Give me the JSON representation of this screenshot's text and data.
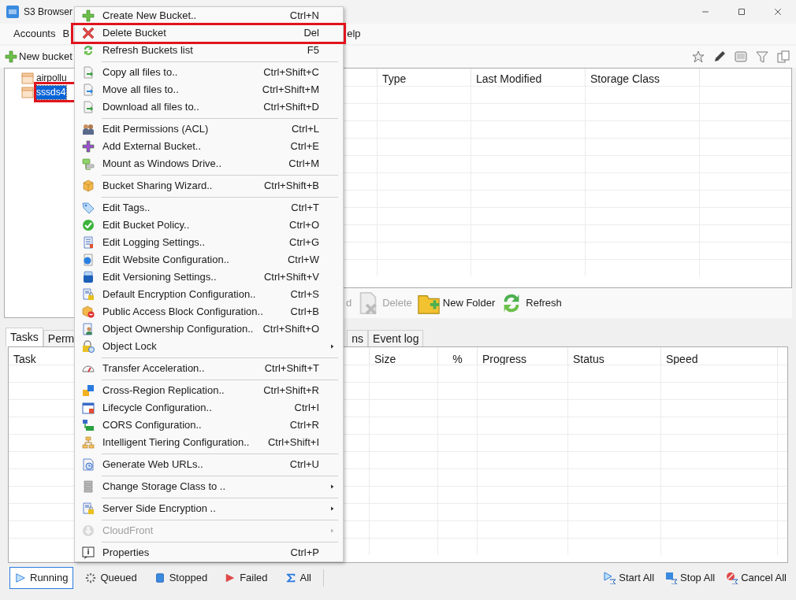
{
  "window": {
    "title": "S3 Browser"
  },
  "menu_bar": [
    "Accounts",
    "B",
    "elp"
  ],
  "toolbar": {
    "new_bucket": "New bucket"
  },
  "tree": [
    {
      "label": "airpollu",
      "selected": false,
      "highlighted": false
    },
    {
      "label": "sssds4",
      "selected": true,
      "highlighted": true
    }
  ],
  "file_list": {
    "columns": [
      "Type",
      "Last Modified",
      "Storage Class"
    ]
  },
  "file_toolbar": [
    {
      "label": "d",
      "disabled": true
    },
    {
      "label": "Delete",
      "disabled": true
    },
    {
      "label": "New Folder",
      "disabled": false
    },
    {
      "label": "Refresh",
      "disabled": false
    }
  ],
  "tabs": [
    {
      "label": "Tasks",
      "selected": true
    },
    {
      "label": "Perm",
      "selected": false
    },
    {
      "label": "ns",
      "selected": false
    },
    {
      "label": "Event log",
      "selected": false
    }
  ],
  "tasks_table": {
    "columns": [
      "Task",
      "Size",
      "%",
      "Progress",
      "Status",
      "Speed"
    ]
  },
  "task_filters": [
    {
      "label": "Running",
      "selected": true
    },
    {
      "label": "Queued",
      "selected": false
    },
    {
      "label": "Stopped",
      "selected": false
    },
    {
      "label": "Failed",
      "selected": false
    },
    {
      "label": "All",
      "selected": false
    }
  ],
  "task_actions": [
    "Start All",
    "Stop All",
    "Cancel All"
  ],
  "context_menu": [
    {
      "kind": "item",
      "label": "Create New Bucket..",
      "shortcut": "Ctrl+N",
      "highlighted": false
    },
    {
      "kind": "item",
      "label": "Delete Bucket",
      "shortcut": "Del",
      "highlighted": true
    },
    {
      "kind": "item",
      "label": "Refresh Buckets list",
      "shortcut": "F5",
      "highlighted": false
    },
    {
      "kind": "separator"
    },
    {
      "kind": "item",
      "label": "Copy all files to..",
      "shortcut": "Ctrl+Shift+C",
      "highlighted": false
    },
    {
      "kind": "item",
      "label": "Move all files to..",
      "shortcut": "Ctrl+Shift+M",
      "highlighted": false
    },
    {
      "kind": "item",
      "label": "Download all files to..",
      "shortcut": "Ctrl+Shift+D",
      "highlighted": false
    },
    {
      "kind": "separator"
    },
    {
      "kind": "item",
      "label": "Edit Permissions (ACL)",
      "shortcut": "Ctrl+L",
      "highlighted": false
    },
    {
      "kind": "item",
      "label": "Add External Bucket..",
      "shortcut": "Ctrl+E",
      "highlighted": false
    },
    {
      "kind": "item",
      "label": "Mount as Windows Drive..",
      "shortcut": "Ctrl+M",
      "highlighted": false
    },
    {
      "kind": "separator"
    },
    {
      "kind": "item",
      "label": "Bucket Sharing Wizard..",
      "shortcut": "Ctrl+Shift+B",
      "highlighted": false
    },
    {
      "kind": "separator"
    },
    {
      "kind": "item",
      "label": "Edit Tags..",
      "shortcut": "Ctrl+T",
      "highlighted": false
    },
    {
      "kind": "item",
      "label": "Edit Bucket Policy..",
      "shortcut": "Ctrl+O",
      "highlighted": false
    },
    {
      "kind": "item",
      "label": "Edit Logging Settings..",
      "shortcut": "Ctrl+G",
      "highlighted": false
    },
    {
      "kind": "item",
      "label": "Edit Website Configuration..",
      "shortcut": "Ctrl+W",
      "highlighted": false
    },
    {
      "kind": "item",
      "label": "Edit Versioning Settings..",
      "shortcut": "Ctrl+Shift+V",
      "highlighted": false
    },
    {
      "kind": "item",
      "label": "Default Encryption Configuration..",
      "shortcut": "Ctrl+S",
      "highlighted": false
    },
    {
      "kind": "item",
      "label": "Public Access Block Configuration..",
      "shortcut": "Ctrl+B",
      "highlighted": false
    },
    {
      "kind": "item",
      "label": "Object Ownership Configuration..",
      "shortcut": "Ctrl+Shift+O",
      "highlighted": false
    },
    {
      "kind": "submenu",
      "label": "Object Lock",
      "disabled": false
    },
    {
      "kind": "separator"
    },
    {
      "kind": "item",
      "label": "Transfer Acceleration..",
      "shortcut": "Ctrl+Shift+T",
      "highlighted": false
    },
    {
      "kind": "separator"
    },
    {
      "kind": "item",
      "label": "Cross-Region Replication..",
      "shortcut": "Ctrl+Shift+R",
      "highlighted": false
    },
    {
      "kind": "item",
      "label": "Lifecycle Configuration..",
      "shortcut": "Ctrl+I",
      "highlighted": false
    },
    {
      "kind": "item",
      "label": "CORS Configuration..",
      "shortcut": "Ctrl+R",
      "highlighted": false
    },
    {
      "kind": "item",
      "label": "Intelligent Tiering Configuration..",
      "shortcut": "Ctrl+Shift+I",
      "highlighted": false
    },
    {
      "kind": "separator"
    },
    {
      "kind": "item",
      "label": "Generate Web URLs..",
      "shortcut": "Ctrl+U",
      "highlighted": false
    },
    {
      "kind": "separator"
    },
    {
      "kind": "submenu",
      "label": "Change Storage Class to ..",
      "disabled": false
    },
    {
      "kind": "separator"
    },
    {
      "kind": "submenu",
      "label": "Server Side Encryption ..",
      "disabled": false
    },
    {
      "kind": "separator"
    },
    {
      "kind": "submenu",
      "label": "CloudFront",
      "disabled": true
    },
    {
      "kind": "separator"
    },
    {
      "kind": "item",
      "label": "Properties",
      "shortcut": "Ctrl+P",
      "highlighted": false
    }
  ]
}
